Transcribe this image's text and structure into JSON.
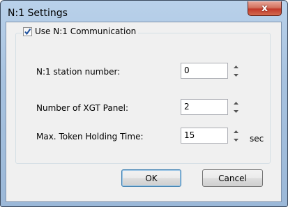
{
  "window": {
    "title": "N:1 Settings",
    "close_label": "x"
  },
  "group": {
    "checkbox_label": "Use N:1 Communication",
    "checked": true
  },
  "fields": [
    {
      "label": "N:1 station number:",
      "value": "0",
      "unit": ""
    },
    {
      "label": "Number of XGT Panel:",
      "value": "2",
      "unit": ""
    },
    {
      "label": "Max. Token Holding Time:",
      "value": "15",
      "unit": "sec"
    }
  ],
  "buttons": {
    "ok": "OK",
    "cancel": "Cancel"
  }
}
